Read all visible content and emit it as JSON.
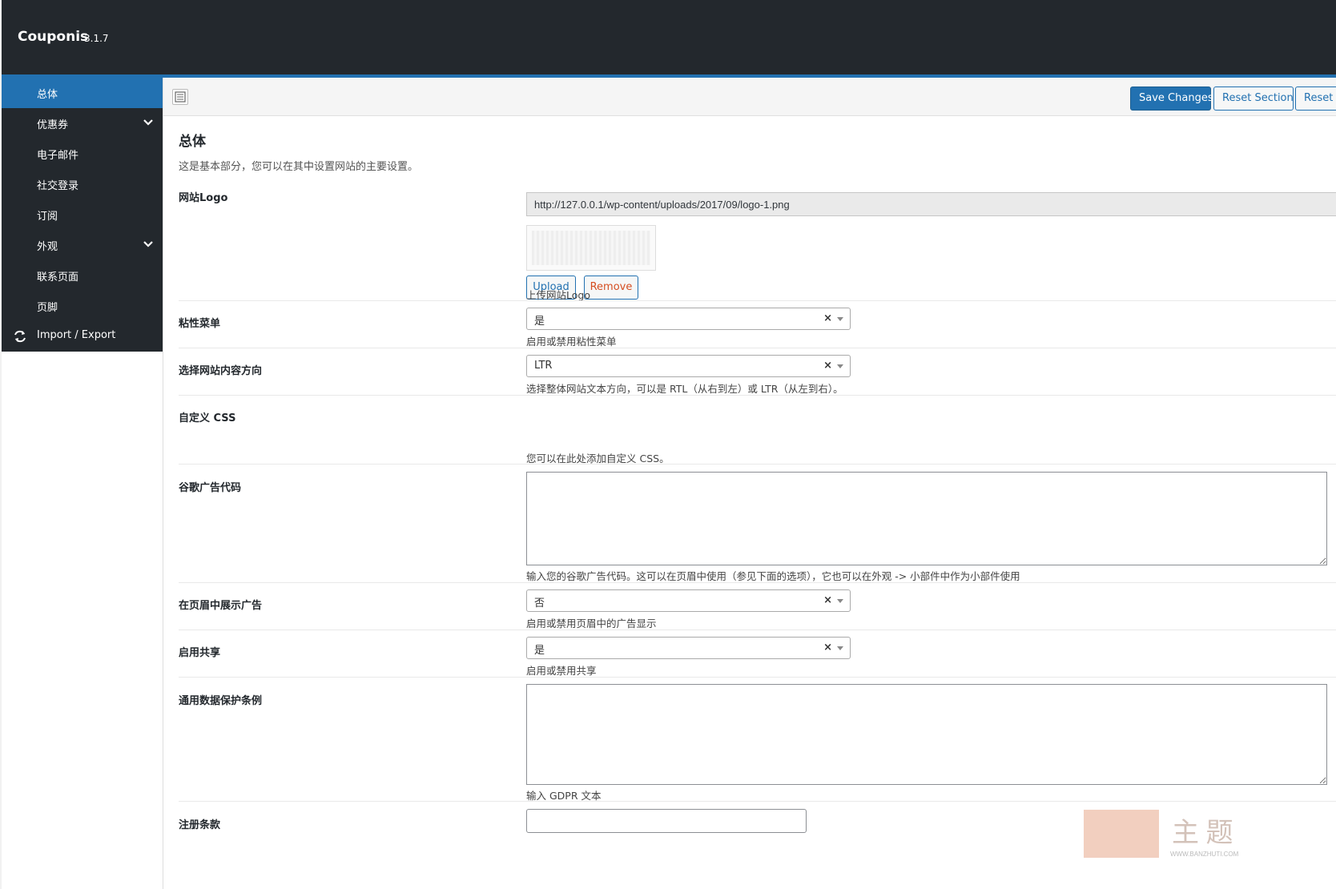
{
  "header": {
    "app_title": "Couponis",
    "version": "3.1.7"
  },
  "sidebar": {
    "items": [
      {
        "label": "总体"
      },
      {
        "label": "优惠券"
      },
      {
        "label": "电子邮件"
      },
      {
        "label": "社交登录"
      },
      {
        "label": "订阅"
      },
      {
        "label": "外观"
      },
      {
        "label": "联系页面"
      },
      {
        "label": "页脚"
      },
      {
        "label": "Import / Export"
      }
    ]
  },
  "toolbar": {
    "save_label": "Save Changes",
    "reset_section_label": "Reset Section",
    "reset_all_label": "Reset Al"
  },
  "section": {
    "title": "总体",
    "description": "这是基本部分，您可以在其中设置网站的主要设置。"
  },
  "fields": {
    "logo": {
      "label": "网站Logo",
      "value": "http://127.0.0.1/wp-content/uploads/2017/09/logo-1.png",
      "upload_label": "Upload",
      "remove_label": "Remove",
      "desc": "上传网站Logo"
    },
    "sticky": {
      "label": "粘性菜单",
      "value": "是",
      "clear": "×",
      "desc": "启用或禁用粘性菜单"
    },
    "direction": {
      "label": "选择网站内容方向",
      "value": "LTR",
      "clear": "×",
      "desc": "选择整体网站文本方向，可以是 RTL（从右到左）或 LTR（从左到右）。"
    },
    "custom_css": {
      "label": "自定义 CSS",
      "desc": "您可以在此处添加自定义 CSS。"
    },
    "google_ads": {
      "label": "谷歌广告代码",
      "value": "",
      "desc": "输入您的谷歌广告代码。这可以在页眉中使用（参见下面的选项），它也可以在外观 -> 小部件中作为小部件使用"
    },
    "header_ads": {
      "label": "在页眉中展示广告",
      "value": "否",
      "clear": "×",
      "desc": "启用或禁用页眉中的广告显示"
    },
    "share": {
      "label": "启用共享",
      "value": "是",
      "clear": "×",
      "desc": "启用或禁用共享"
    },
    "gdpr": {
      "label": "通用数据保护条例",
      "value": "",
      "desc": "输入 GDPR 文本"
    },
    "register_terms": {
      "label": "注册条款",
      "value": ""
    }
  },
  "watermark": {
    "text": "主 题",
    "url": "WWW.BANZHUTI.COM"
  },
  "colors": {
    "header_bg": "#23282d",
    "accent": "#2271b1",
    "active_item": "#2271b1",
    "remove": "#d54e21"
  }
}
